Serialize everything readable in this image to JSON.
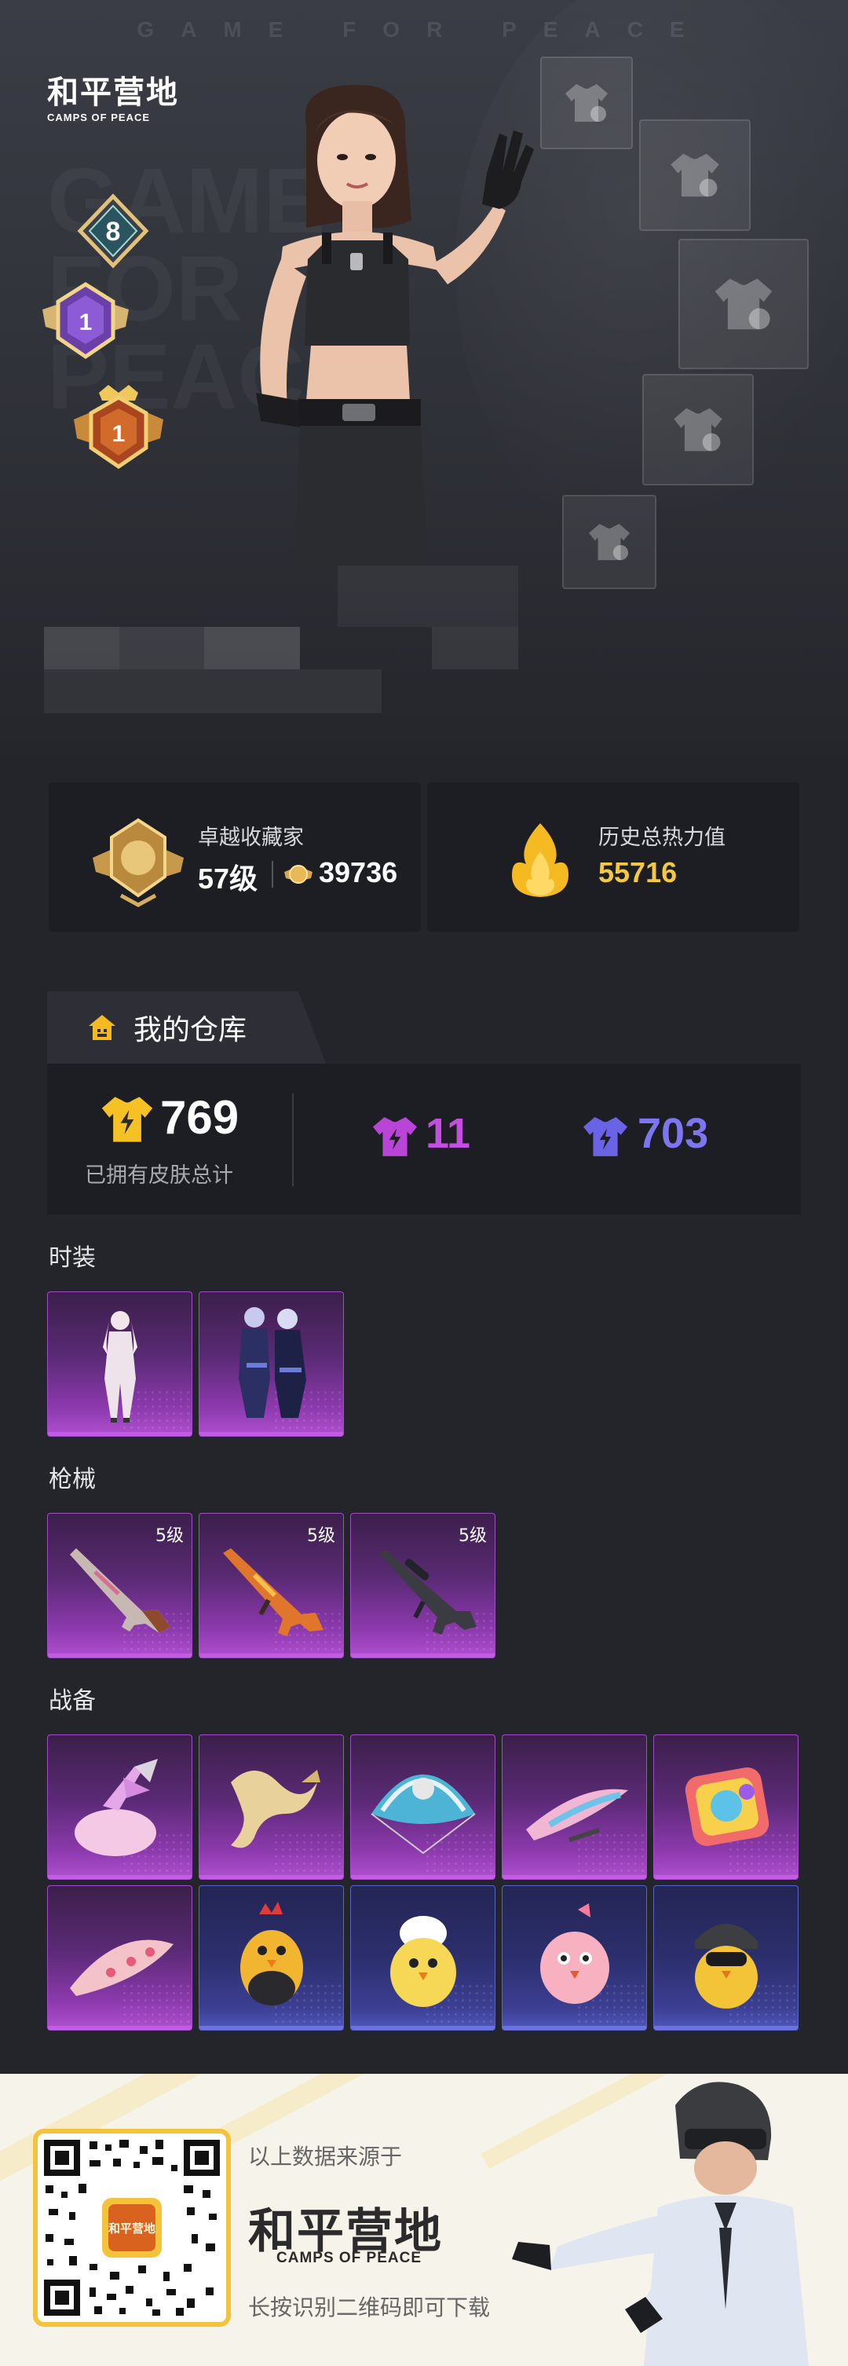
{
  "hero": {
    "watermark_top": "GAME FOR PEACE",
    "watermark_big": "GAME FOR PEACE",
    "logo_cn": "和平营地",
    "logo_en": "CAMPS OF PEACE",
    "rank_badges": [
      {
        "label": "8"
      },
      {
        "label": "1"
      },
      {
        "label": "1"
      }
    ]
  },
  "stats": {
    "collector": {
      "title": "卓越收藏家",
      "level": "57级",
      "points": "39736"
    },
    "heat": {
      "title": "历史总热力值",
      "value": "55716"
    }
  },
  "warehouse": {
    "tab_label": "我的仓库",
    "total_value": "769",
    "total_label": "已拥有皮肤总计",
    "purple_count": "11",
    "blue_count": "703"
  },
  "sections": {
    "fashion": "时装",
    "weapons": "枪械",
    "gear": "战备"
  },
  "weapon_levels": [
    "5级",
    "5级",
    "5级"
  ],
  "footer": {
    "source_text": "以上数据来源于",
    "logo_cn": "和平营地",
    "logo_en": "CAMPS OF PEACE",
    "download_text": "长按识别二维码即可下载",
    "qr_center_text": "和平营地"
  },
  "colors": {
    "page_bg": "#24252b",
    "card_bg": "#1d1e23",
    "gold": "#f3c843",
    "purple_accent": "#b845d6",
    "blue_accent": "#6b63e6"
  }
}
